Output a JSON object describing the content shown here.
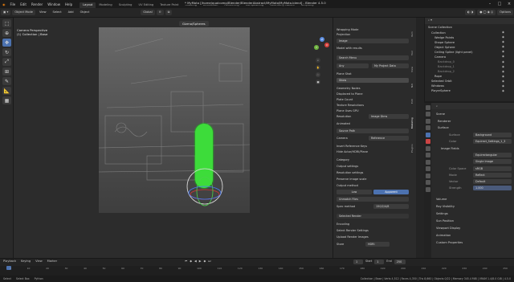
{
  "app": {
    "title": "* MyMoto [/home/qualcomp/Blender/BlenderAbstract/MyMoto/MyMoto.blend] - Blender 4.5.0",
    "menu": [
      "File",
      "Edit",
      "Render",
      "Window",
      "Help"
    ],
    "workspaces": [
      "Layout",
      "Modeling",
      "Sculpting",
      "UV Editing",
      "Texture Paint",
      "Shading",
      "Animation",
      "Rendering",
      "Compositing",
      "Geometry Nodes",
      "Scripting"
    ],
    "active_workspace": "Layout"
  },
  "header2": {
    "mode": "Object Mode",
    "items": [
      "View",
      "Select",
      "Add",
      "Object"
    ],
    "transform": "Global",
    "overlay_label": "Options"
  },
  "viewport": {
    "camera_label": "Camera Perspective",
    "collection_label": "(1) Collection | Base",
    "gizmo_axes": [
      "X",
      "Y",
      "Z"
    ],
    "top_field": "Gizmo/Spheres"
  },
  "npanel": {
    "rows": [
      "Wrapping Mode",
      "Projection",
      "Image",
      "Model with results",
      "Search Menu",
      "Plane Shot",
      "Show",
      "Geometry Nodes",
      "Displaced to Plane",
      "Plate Count",
      "Texture Resolutions",
      "Plane Uses GPU",
      "Resolution",
      "Animated",
      "Source Path",
      "Camera",
      "Insert Reference Keys",
      "Hide Actor/HDRI/Plane",
      "Category",
      "Output settings",
      "Resolution settings",
      "Preserve image scale",
      "Output method",
      "Unmatch Files",
      "Spec method",
      "Selected Render",
      "Encoding",
      "Select Render Settings",
      "Upload Render Images",
      "Store"
    ],
    "fields": {
      "add": "Any",
      "from_image": "My Project Data",
      "resolution": "Image Dims",
      "camera": "Reference",
      "spec_value": "150/2/4/8",
      "left_btn": "Low",
      "right_btn": "Apparent",
      "store": "HDRI"
    },
    "tabs": [
      "Item",
      "Tool",
      "View",
      "NAI",
      "Edit",
      "Modeling",
      "Plugins"
    ]
  },
  "outliner": {
    "title": "Scene Collection",
    "rows": [
      "Collection",
      "Wedge Points",
      "Shape Sphere",
      "Object Sphere",
      "Ceiling Spline (light panel)",
      "Camera",
      "Backdrop_0",
      "Backdrop_1",
      "Backdrop_2",
      "Rope",
      "Selected Orbit",
      "Windows",
      "PlayerSphere"
    ]
  },
  "properties": {
    "tabs": [
      "Scene",
      "View Layer"
    ],
    "rows": [
      "Scene",
      "Renderer",
      "Surface",
      "Surface",
      "Color",
      "Image Fields",
      "Color Space",
      "Vector",
      "Strength",
      "Mode",
      "Volume",
      "Ray Visibility",
      "Settings",
      "Sun Position",
      "Viewport Display",
      "Animation",
      "Custom Properties"
    ],
    "values": {
      "surface": "Background",
      "color": "Equirect_Settings_1_3",
      "image_fields": "Equirectangular",
      "single_image": "Single Image",
      "color_space": "sRGB",
      "mode": "Reflect",
      "vector": "Default",
      "strength": "1.000"
    }
  },
  "timeline": {
    "controls": [
      "Playback",
      "Keying",
      "View",
      "Marker"
    ],
    "frame_ticks": [
      "0",
      "10",
      "20",
      "30",
      "40",
      "50",
      "60",
      "70",
      "80",
      "90",
      "100",
      "110",
      "120",
      "130",
      "140",
      "150",
      "160",
      "170",
      "180",
      "190",
      "200",
      "210",
      "220",
      "230",
      "240",
      "250"
    ],
    "start_label": "Start",
    "start": "1",
    "end_label": "End",
    "end": "250",
    "current": "1"
  },
  "status": {
    "left": [
      "Select",
      "Select Box",
      "Python"
    ],
    "right": "Collection | Base | Verts 4,512 | Faces 4,350 | Tris 8,660 | Objects 0/22 | Memory 345.4 MiB | VRAM 1.4/8.0 GiB | 4.5.0"
  },
  "colors": {
    "accent": "#4c72b0",
    "green_object": "#3ddc3a",
    "selected_button": "#4c72b0"
  }
}
